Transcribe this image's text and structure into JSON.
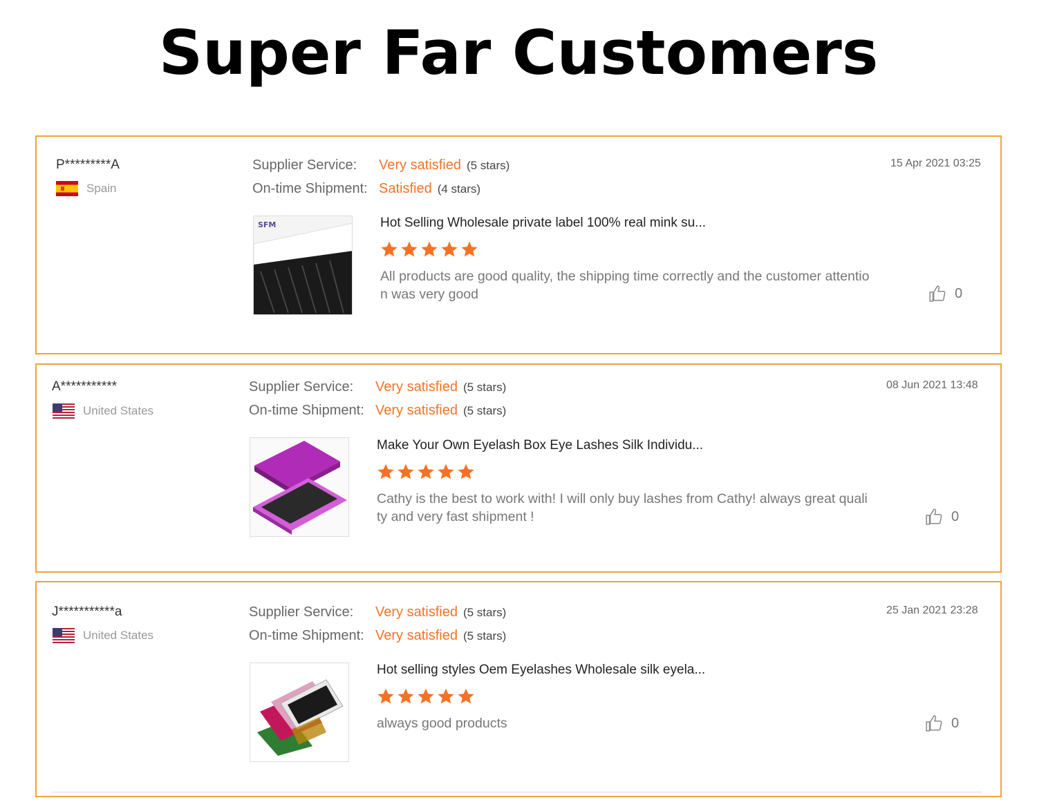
{
  "title": "Super Far Customers",
  "colors": {
    "accent": "#f57224",
    "border": "#f0a33a"
  },
  "labels": {
    "supplier": "Supplier Service:",
    "shipment": "On-time Shipment:"
  },
  "reviews": [
    {
      "user": "P*********A",
      "country": "Spain",
      "flag_icon": "spain-flag-icon",
      "supplier_rating": "Very satisfied",
      "supplier_stars": "(5 stars)",
      "shipment_rating": "Satisfied",
      "shipment_stars": "(4 stars)",
      "date": "15 Apr 2021 03:25",
      "product_title": "Hot Selling Wholesale private label 100% real mink su...",
      "product_stars": 5,
      "text": "All products are good quality, the shipping time correctly and the customer attention was very good",
      "likes": "0",
      "logo_text": "SFM"
    },
    {
      "user": "A***********",
      "country": "United States",
      "flag_icon": "us-flag-icon",
      "supplier_rating": "Very satisfied",
      "supplier_stars": "(5 stars)",
      "shipment_rating": "Very satisfied",
      "shipment_stars": "(5 stars)",
      "date": "08 Jun 2021 13:48",
      "product_title": "Make Your Own Eyelash Box Eye Lashes Silk Individu...",
      "product_stars": 5,
      "text": "Cathy is the best to work with! I will only buy lashes from Cathy! always great quality and very fast shipment !",
      "likes": "0"
    },
    {
      "user": "J***********a",
      "country": "United States",
      "flag_icon": "us-flag-icon",
      "supplier_rating": "Very satisfied",
      "supplier_stars": "(5 stars)",
      "shipment_rating": "Very satisfied",
      "shipment_stars": "(5 stars)",
      "date": "25 Jan 2021 23:28",
      "product_title": "Hot selling styles Oem Eyelashes Wholesale silk eyela...",
      "product_stars": 5,
      "text": "always good products",
      "likes": "0"
    }
  ]
}
